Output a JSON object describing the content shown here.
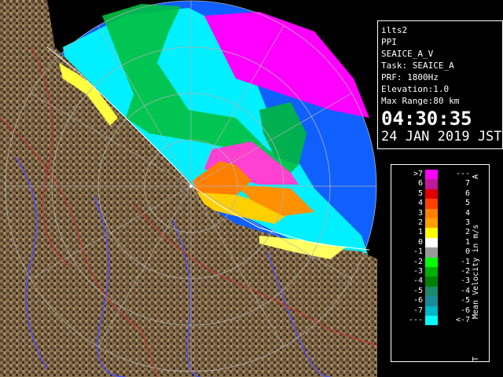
{
  "info": {
    "station": "ilts2",
    "product": "PPI",
    "task_name": "SEAICE_A_V",
    "task": "Task: SEAICE_A",
    "prf": "PRF: 1800Hz",
    "elevation": "Elevation:1.0",
    "max_range": "Max Range:80 km",
    "time": "04:30:35",
    "date": "24 JAN 2019 JST"
  },
  "legend": {
    "title": "Mean Velocity in m/s",
    "top_marker": "A",
    "bottom_marker": "T",
    "rows": [
      {
        "left": ">7",
        "right": "---",
        "color": "#ff00ff"
      },
      {
        "left": "6",
        "right": "7",
        "color": "#c0189a"
      },
      {
        "left": "5",
        "right": "6",
        "color": "#e00000"
      },
      {
        "left": "4",
        "right": "5",
        "color": "#ff4000"
      },
      {
        "left": "3",
        "right": "4",
        "color": "#ff8000"
      },
      {
        "left": "2",
        "right": "3",
        "color": "#ffa000"
      },
      {
        "left": "1",
        "right": "2",
        "color": "#ffff00"
      },
      {
        "left": "0",
        "right": "1",
        "color": "#ffffff"
      },
      {
        "left": "-1",
        "right": "0",
        "color": "#9a9a9a"
      },
      {
        "left": "-2",
        "right": "-1",
        "color": "#00ff00"
      },
      {
        "left": "-3",
        "right": "-2",
        "color": "#00b000"
      },
      {
        "left": "-4",
        "right": "-3",
        "color": "#008000"
      },
      {
        "left": "-5",
        "right": "-4",
        "color": "#1a8a6a"
      },
      {
        "left": "-6",
        "right": "-5",
        "color": "#1a8a9a"
      },
      {
        "left": "-7",
        "right": "-6",
        "color": "#00b8c8"
      },
      {
        "left": "---",
        "right": "<-7",
        "color": "#00ffff"
      }
    ]
  },
  "map_colors": {
    "ocean": "#1060ff",
    "land": "#8c7350",
    "river": "#5050ff",
    "border": "#c03030",
    "range_ring": "#b0b0b0"
  }
}
